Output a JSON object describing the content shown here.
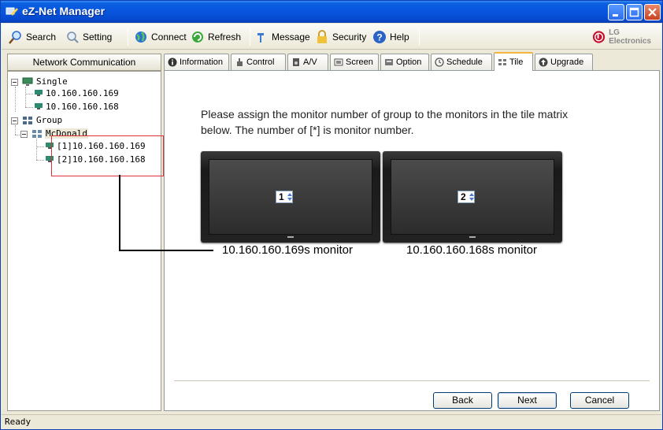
{
  "window": {
    "title": "eZ-Net Manager"
  },
  "toolbar": {
    "search_label": "Search",
    "setting_label": "Setting",
    "connect_label": "Connect",
    "refresh_label": "Refresh",
    "message_label": "Message",
    "security_label": "Security",
    "help_label": "Help",
    "brand_label": "LG Electronics"
  },
  "sidebar": {
    "header": "Network Communication",
    "single_label": "Single",
    "single_items": [
      "10.160.160.169",
      "10.160.160.168"
    ],
    "group_label": "Group",
    "group_name": "McDonald",
    "group_items": [
      "[1]10.160.160.169",
      "[2]10.160.160.168"
    ]
  },
  "tabs": [
    "Information",
    "Control",
    "A/V",
    "Screen",
    "Option",
    "Schedule",
    "Tile",
    "Upgrade"
  ],
  "tile": {
    "instruction": "Please assign the monitor number of group to the monitors in the tile matrix below. The number of [*] is monitor number.",
    "monitors": [
      {
        "number": "1",
        "label": "10.160.160.169s monitor"
      },
      {
        "number": "2",
        "label": "10.160.160.168s monitor"
      }
    ]
  },
  "buttons": {
    "back": "Back",
    "next": "Next",
    "cancel": "Cancel"
  },
  "status": {
    "text": "Ready"
  },
  "colors": {
    "titlebar": "#0855dd",
    "active_tab_accent": "#f3b53f",
    "annotation_box": "#e0303a"
  }
}
